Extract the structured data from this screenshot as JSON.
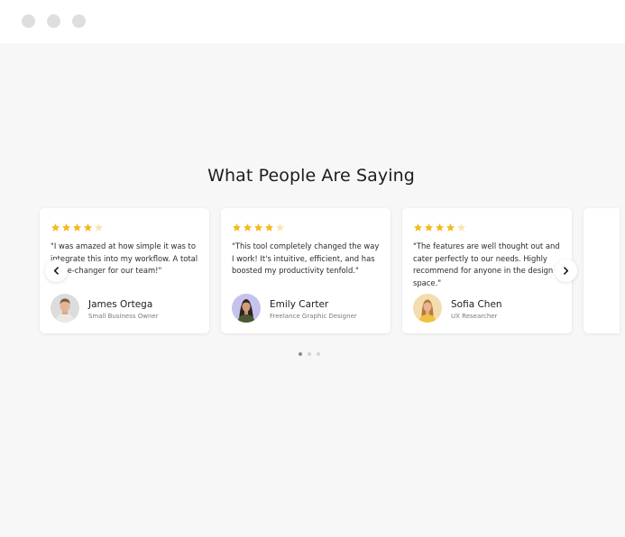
{
  "window": {
    "controls": [
      "window-control-dot",
      "window-control-dot",
      "window-control-dot"
    ]
  },
  "section": {
    "title": "What People Are Saying"
  },
  "colors": {
    "star_filled": "#f5b81c",
    "star_empty": "#f7e6b3",
    "background": "#f7f7f7"
  },
  "testimonials": [
    {
      "rating": 4,
      "quote": "\"I was amazed at how simple it was to integrate this into my workflow. A total game-changer for our team!\"",
      "name": "James Ortega",
      "role": "Small Business Owner",
      "avatar_icon": "man-portrait-avatar"
    },
    {
      "rating": 4,
      "quote": "\"This tool completely changed the way I work! It's intuitive, efficient, and has boosted my productivity tenfold.\"",
      "name": "Emily Carter",
      "role": "Freelance Graphic Designer",
      "avatar_icon": "woman-portrait-avatar"
    },
    {
      "rating": 4,
      "quote": "\"The features are well thought out and cater perfectly to our needs. Highly recommend for anyone in the design space.\"",
      "name": "Sofia Chen",
      "role": "UX Researcher",
      "avatar_icon": "woman-portrait-avatar"
    }
  ],
  "navigation": {
    "prev_icon": "chevron-left-icon",
    "next_icon": "chevron-right-icon"
  },
  "pagination": {
    "pages": 3,
    "active_page": 1
  }
}
